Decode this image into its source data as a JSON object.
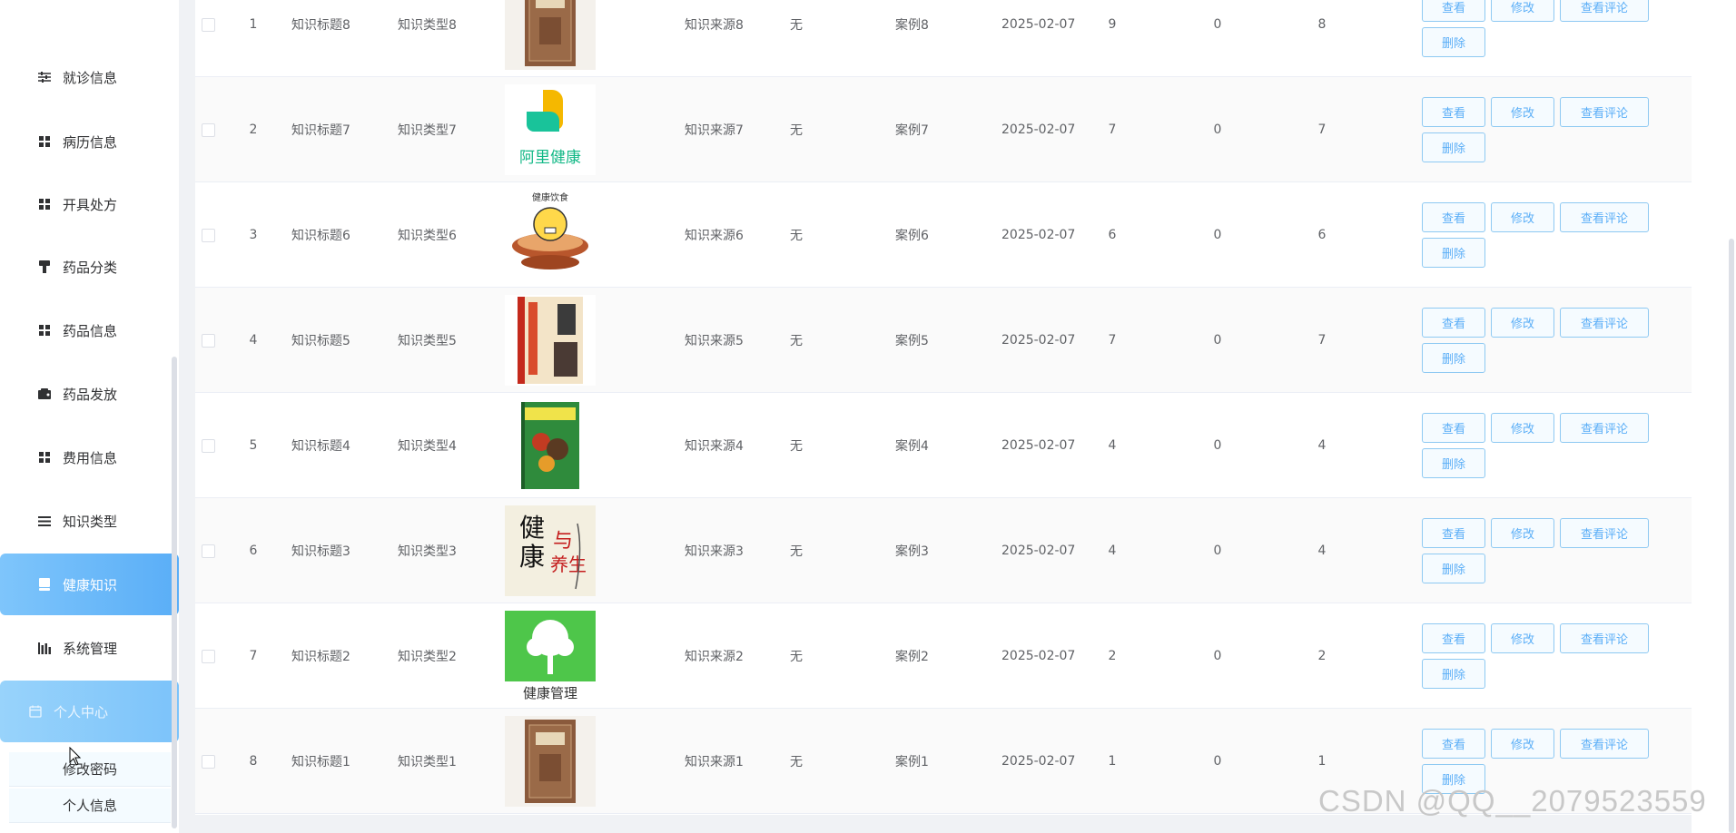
{
  "sidebar": {
    "items": [
      {
        "label": "就诊信息",
        "icon": "sliders-icon"
      },
      {
        "label": "病历信息",
        "icon": "grid-icon"
      },
      {
        "label": "开具处方",
        "icon": "grid-icon"
      },
      {
        "label": "药品分类",
        "icon": "brush-icon"
      },
      {
        "label": "药品信息",
        "icon": "grid-icon"
      },
      {
        "label": "药品发放",
        "icon": "wallet-icon"
      },
      {
        "label": "费用信息",
        "icon": "grid-icon"
      },
      {
        "label": "知识类型",
        "icon": "menu-icon"
      },
      {
        "label": "健康知识",
        "icon": "book-icon"
      },
      {
        "label": "系统管理",
        "icon": "chart-icon"
      },
      {
        "label": "个人中心",
        "icon": "calendar-icon"
      }
    ],
    "submenu": [
      {
        "label": "修改密码"
      },
      {
        "label": "个人信息"
      }
    ]
  },
  "table": {
    "rows": [
      {
        "index": "1",
        "title": "知识标题8",
        "type": "知识类型8",
        "image": "book-cover",
        "source": "知识来源8",
        "none": "无",
        "case": "案例8",
        "date": "2025-02-07",
        "n1": "9",
        "n2": "0",
        "n3": "8"
      },
      {
        "index": "2",
        "title": "知识标题7",
        "type": "知识类型7",
        "image": "ali-health-logo",
        "image_text": "阿里健康",
        "source": "知识来源7",
        "none": "无",
        "case": "案例7",
        "date": "2025-02-07",
        "n1": "7",
        "n2": "0",
        "n3": "7"
      },
      {
        "index": "3",
        "title": "知识标题6",
        "type": "知识类型6",
        "image": "healthy-diet-pot",
        "image_text": "健康饮食",
        "source": "知识来源6",
        "none": "无",
        "case": "案例6",
        "date": "2025-02-07",
        "n1": "6",
        "n2": "0",
        "n3": "6"
      },
      {
        "index": "4",
        "title": "知识标题5",
        "type": "知识类型5",
        "image": "health-book-cover",
        "source": "知识来源5",
        "none": "无",
        "case": "案例5",
        "date": "2025-02-07",
        "n1": "7",
        "n2": "0",
        "n3": "7"
      },
      {
        "index": "5",
        "title": "知识标题4",
        "type": "知识类型4",
        "image": "diet-book-cover",
        "source": "知识来源4",
        "none": "无",
        "case": "案例4",
        "date": "2025-02-07",
        "n1": "4",
        "n2": "0",
        "n3": "4"
      },
      {
        "index": "6",
        "title": "知识标题3",
        "type": "知识类型3",
        "image": "health-beauty-poster",
        "image_text": "健康与养生",
        "source": "知识来源3",
        "none": "无",
        "case": "案例3",
        "date": "2025-02-07",
        "n1": "4",
        "n2": "0",
        "n3": "4"
      },
      {
        "index": "7",
        "title": "知识标题2",
        "type": "知识类型2",
        "image": "health-management-tree",
        "image_text": "健康管理",
        "source": "知识来源2",
        "none": "无",
        "case": "案例2",
        "date": "2025-02-07",
        "n1": "2",
        "n2": "0",
        "n3": "2"
      },
      {
        "index": "8",
        "title": "知识标题1",
        "type": "知识类型1",
        "image": "book-cover",
        "source": "知识来源1",
        "none": "无",
        "case": "案例1",
        "date": "2025-02-07",
        "n1": "1",
        "n2": "0",
        "n3": "1"
      }
    ],
    "actions": {
      "view": "查看",
      "edit": "修改",
      "comments": "查看评论",
      "delete": "删除"
    }
  },
  "watermark": "CSDN @QQ__2079523559",
  "colors": {
    "accent": "#5aaef7",
    "button_border": "#8ec9f2",
    "sidebar_bg": "#ffffff",
    "page_bg": "#f0f2f5"
  }
}
